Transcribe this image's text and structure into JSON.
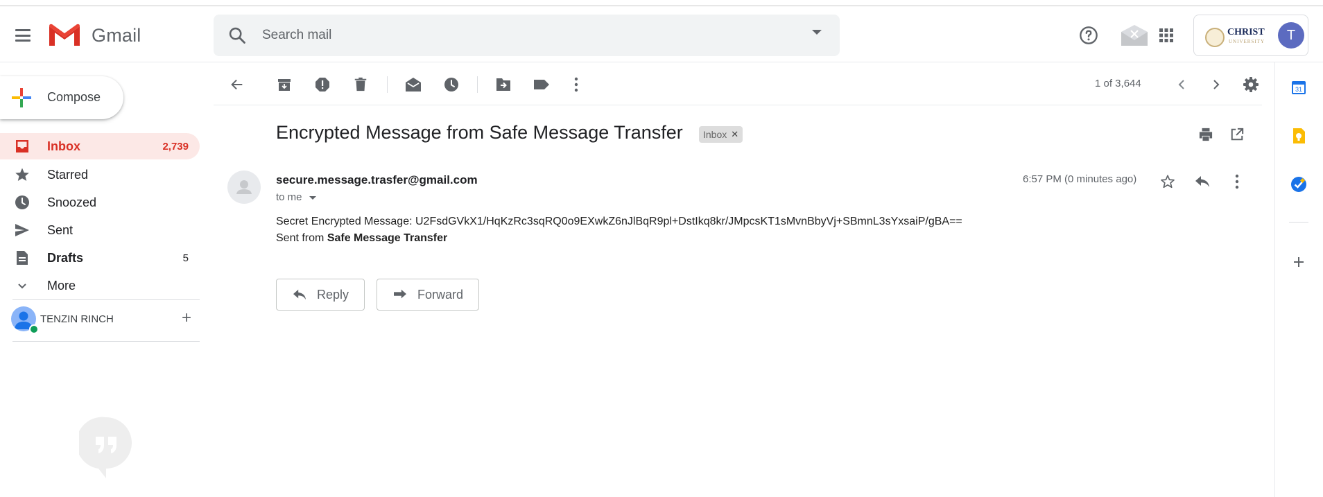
{
  "app": {
    "name": "Gmail"
  },
  "search": {
    "placeholder": "Search mail"
  },
  "org": {
    "line1": "CHRIST",
    "line2": "UNIVERSITY"
  },
  "account": {
    "initial": "T"
  },
  "compose": {
    "label": "Compose"
  },
  "sidebar": {
    "items": [
      {
        "label": "Inbox",
        "count": "2,739"
      },
      {
        "label": "Starred",
        "count": ""
      },
      {
        "label": "Snoozed",
        "count": ""
      },
      {
        "label": "Sent",
        "count": ""
      },
      {
        "label": "Drafts",
        "count": "5"
      },
      {
        "label": "More",
        "count": ""
      }
    ]
  },
  "hangouts": {
    "user": "TENZIN RINCH"
  },
  "toolbar": {
    "pager": "1 of 3,644"
  },
  "message": {
    "subject": "Encrypted Message from Safe Message Transfer",
    "label": "Inbox",
    "sender": "secure.message.trasfer@gmail.com",
    "to": "to me",
    "time": "6:57 PM (0 minutes ago)",
    "body_line1": "Secret Encrypted Message: U2FsdGVkX1/HqKzRc3sqRQ0o9EXwkZ6nJlBqR9pl+DstIkq8kr/JMpcsKT1sMvnBbyVj+SBmnL3sYxsaiP/gBA==",
    "body_line2_prefix": "Sent from ",
    "body_line2_bold": "Safe Message Transfer"
  },
  "actions": {
    "reply": "Reply",
    "forward": "Forward"
  },
  "colors": {
    "accent_red": "#d93025",
    "inbox_bg": "#fce8e6",
    "avatar": "#5c6bc0"
  }
}
